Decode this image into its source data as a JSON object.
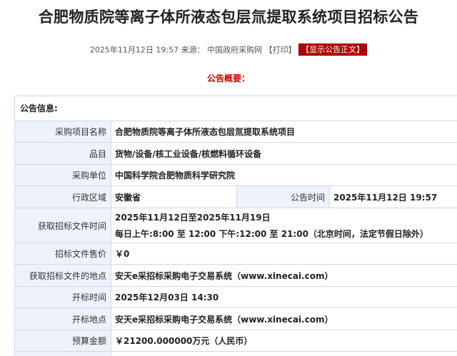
{
  "title": "合肥物质院等离子体所液态包层氚提取系统项目招标公告",
  "meta": {
    "datetime": "2025年11月12日 19:57",
    "source_label": "来源：",
    "source": "中国政府采购网",
    "print": "【打印】",
    "show_body": "【显示公告正文】"
  },
  "summary_title": "公告概要：",
  "info": {
    "heading": "公告信息:",
    "project_name_label": "采购项目名称",
    "project_name": "合肥物质院等离子体所液态包层氚提取系统项目",
    "category_label": "品目",
    "category": "货物/设备/核工业设备/核燃料循环设备",
    "buyer_label": "采购单位",
    "buyer": "中国科学院合肥物质科学研究院",
    "region_label": "行政区域",
    "region": "安徽省",
    "pub_time_label": "公告时间",
    "pub_time": "2025年11月12日 19:57",
    "doc_time_label": "获取招标文件时间",
    "doc_time_line1": "2025年11月12日至2025年11月19日",
    "doc_time_line2": "每日上午:8:00 至 12:00  下午:12:00 至 21:00（北京时间，法定节假日除外）",
    "doc_price_label": "招标文件售价",
    "doc_price": "￥0",
    "doc_place_label": "获取招标文件的地点",
    "doc_place": "安天e采招标采购电子交易系统（www.xinecai.com）",
    "open_time_label": "开标时间",
    "open_time": "2025年12月03日 14:30",
    "open_place_label": "开标地点",
    "open_place": "安天e采招标采购电子交易系统（www.xinecai.com）",
    "budget_label": "预算金额",
    "budget": "￥21200.000000万元（人民币）"
  }
}
